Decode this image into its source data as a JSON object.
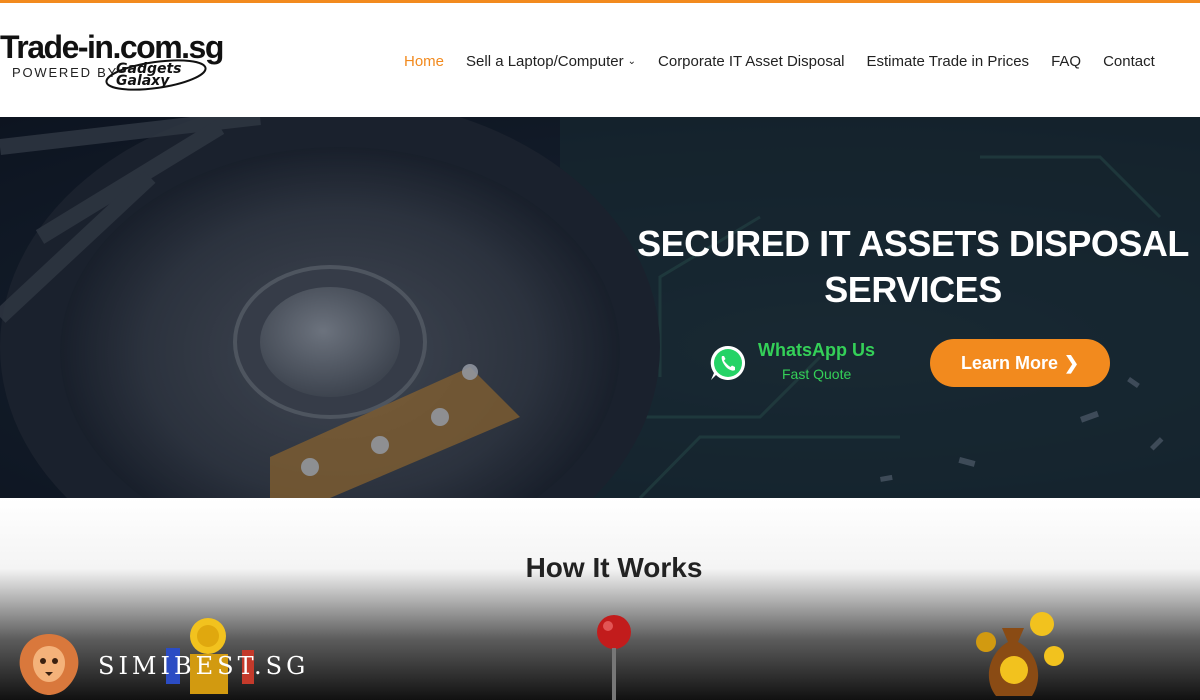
{
  "header": {
    "logo": {
      "title": "Trade-in.com.sg",
      "powered_by": "POWERED BY",
      "brand": "Gadgets Galaxy"
    },
    "nav": [
      {
        "label": "Home",
        "active": true,
        "has_dropdown": false
      },
      {
        "label": "Sell a Laptop/Computer",
        "active": false,
        "has_dropdown": true
      },
      {
        "label": "Corporate IT Asset Disposal",
        "active": false,
        "has_dropdown": false
      },
      {
        "label": "Estimate Trade in Prices",
        "active": false,
        "has_dropdown": false
      },
      {
        "label": "FAQ",
        "active": false,
        "has_dropdown": false
      },
      {
        "label": "Contact",
        "active": false,
        "has_dropdown": false
      }
    ],
    "dropdown_icon": "chevron-down-icon"
  },
  "hero": {
    "title_line1": "SECURED IT ASSETS DISPOSAL",
    "title_line2": "SERVICES",
    "whatsapp": {
      "label": "WhatsApp Us",
      "sublabel": "Fast Quote",
      "icon": "whatsapp-icon"
    },
    "cta": {
      "label": "Learn More",
      "icon": "chevron-right-icon"
    }
  },
  "how_it_works": {
    "title": "How It Works"
  },
  "watermark": {
    "text": "SIMIBEST.SG",
    "icon": "lion-icon"
  },
  "colors": {
    "accent": "#f28a1e",
    "whatsapp_green": "#34d058",
    "text_dark": "#222222"
  }
}
